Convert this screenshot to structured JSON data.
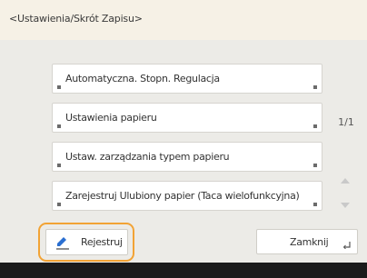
{
  "header": {
    "title": "<Ustawienia/Skrót Zapisu>"
  },
  "menu": {
    "items": [
      {
        "label": "Automatyczna. Stopn. Regulacja"
      },
      {
        "label": "Ustawienia papieru"
      },
      {
        "label": "Ustaw. zarządzania typem papieru"
      },
      {
        "label": "Zarejestruj Ulubiony papier (Taca wielofunkcyjna)"
      }
    ]
  },
  "pager": {
    "text": "1/1"
  },
  "footer": {
    "register_label": "Rejestruj",
    "close_label": "Zamknij"
  },
  "colors": {
    "highlight": "#f2a335",
    "header_bg": "#f6f1e6",
    "panel_bg": "#ecebe7",
    "bottom_bar": "#1b1b1b",
    "icon_blue": "#2a6fd1"
  },
  "icons": [
    "corner-marker-icon",
    "scroll-up-icon",
    "scroll-down-icon",
    "pen-register-icon",
    "enter-icon"
  ]
}
